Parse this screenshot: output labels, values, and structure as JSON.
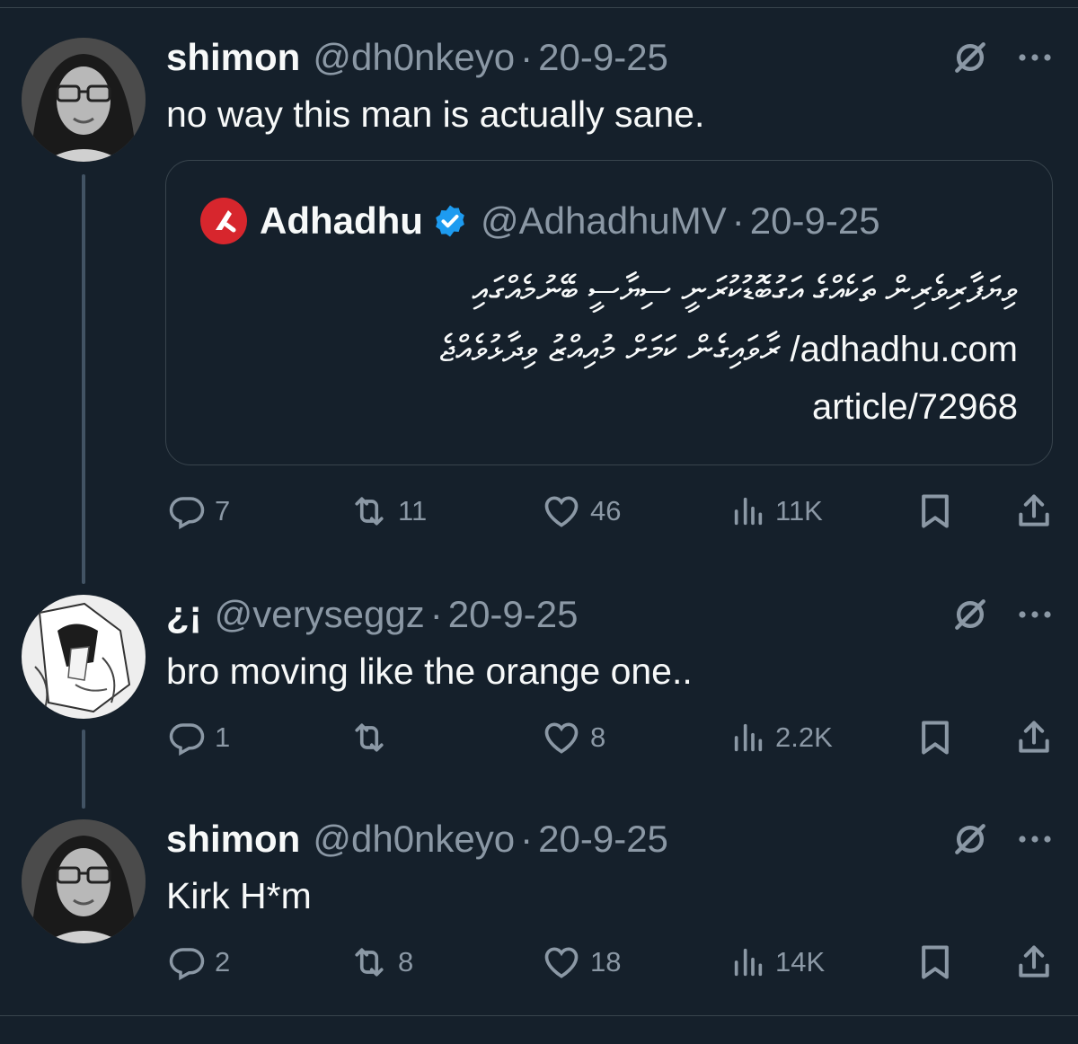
{
  "tweets": [
    {
      "name": "shimon",
      "handle": "@dh0nkeyo",
      "date": "20-9-25",
      "text": "no way this man is actually sane.",
      "quote": {
        "name": "Adhadhu",
        "handle": "@AdhadhuMV",
        "date": "20-9-25",
        "line1": "ވިޔަފާރިވެރިން ތަކެއްގެ އަގުބޮޑުކުރަނީ ސިޔާސީ ބޭނުމެއްގައި",
        "line2": "adhadhu.com/ ރާވައިގެން ކަމަށް މުއިއްޒު ވިދާޅުވެއްޖެ",
        "line3": "article/72968"
      },
      "replies": "7",
      "reposts": "11",
      "likes": "46",
      "views": "11K"
    },
    {
      "name": "¿¡",
      "handle": "@veryseggz",
      "date": "20-9-25",
      "text": "bro moving like the orange one..",
      "replies": "1",
      "reposts": "",
      "likes": "8",
      "views": "2.2K"
    },
    {
      "name": "shimon",
      "handle": "@dh0nkeyo",
      "date": "20-9-25",
      "text": "Kirk H*m",
      "replies": "2",
      "reposts": "8",
      "likes": "18",
      "views": "14K"
    }
  ],
  "separator": "·",
  "icons": [
    "grok-icon",
    "more-icon",
    "reply-icon",
    "repost-icon",
    "like-icon",
    "views-icon",
    "bookmark-icon",
    "share-icon",
    "verified-icon"
  ],
  "colors": {
    "background": "#15202b",
    "text": "#f7f9f9",
    "secondary": "#8b98a5",
    "border": "#38444d",
    "verified": "#1d9bf0",
    "adhadhu_logo": "#d7262d"
  }
}
